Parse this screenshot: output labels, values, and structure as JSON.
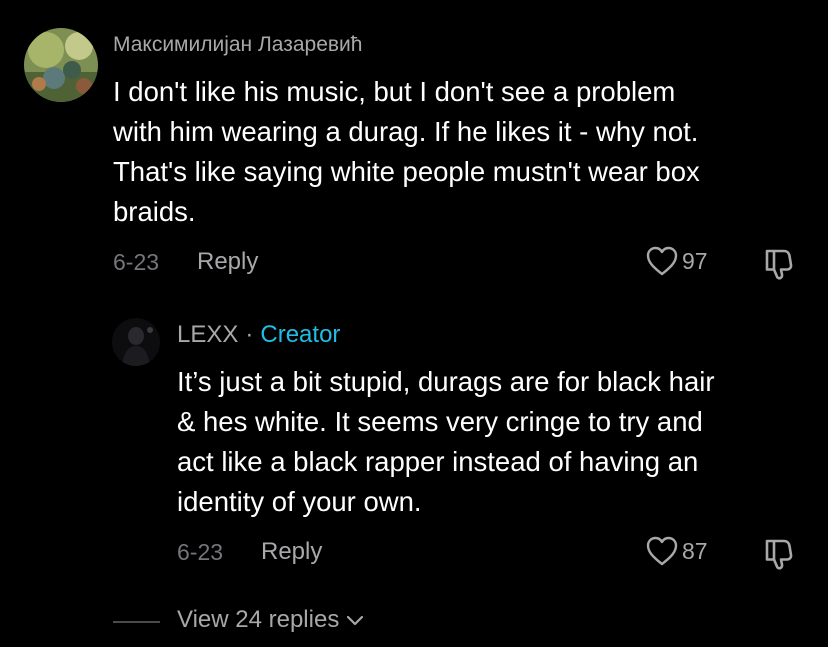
{
  "comment": {
    "username": "Максимилијан Лазаревић",
    "text_lines": [
      "I don't like his music, but I don't see a problem",
      "with him wearing a durag. If he likes it - why not.",
      "That's like saying white people mustn't wear box",
      "braids."
    ],
    "date": "6-23",
    "reply_label": "Reply",
    "likes": "97"
  },
  "reply": {
    "username": "LEXX",
    "separator": "·",
    "badge": "Creator",
    "text_lines": [
      "It’s just a bit stupid, durags are for black hair",
      "& hes white. It seems very cringe to try and",
      "act like a black rapper instead of having an",
      "identity of your own."
    ],
    "date": "6-23",
    "reply_label": "Reply",
    "likes": "87"
  },
  "view_replies": {
    "label": "View 24 replies",
    "icon": "chevron-down-icon"
  },
  "colors": {
    "background": "#000000",
    "text": "#ffffff",
    "muted": "#a8a8ab",
    "date": "#75757a",
    "creator_accent": "#20bde4"
  }
}
